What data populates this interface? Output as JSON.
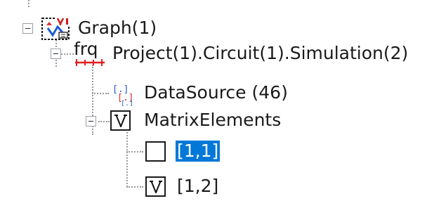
{
  "tree": {
    "graph": {
      "label": "Graph(1)",
      "expanded": true
    },
    "project": {
      "prefix": "frq",
      "label": "Project(1).Circuit(1).Simulation(2)",
      "expanded": true
    },
    "datasource": {
      "label": "DataSource (46)"
    },
    "matrix": {
      "label": "MatrixElements",
      "expanded": true,
      "checked": true
    },
    "items": [
      {
        "label": "[1,1]",
        "checked": false,
        "selected": true
      },
      {
        "label": "[1,2]",
        "checked": true,
        "selected": false
      }
    ]
  },
  "colors": {
    "selection": "#0078d7",
    "tree_lines": "#9a9a9a"
  }
}
